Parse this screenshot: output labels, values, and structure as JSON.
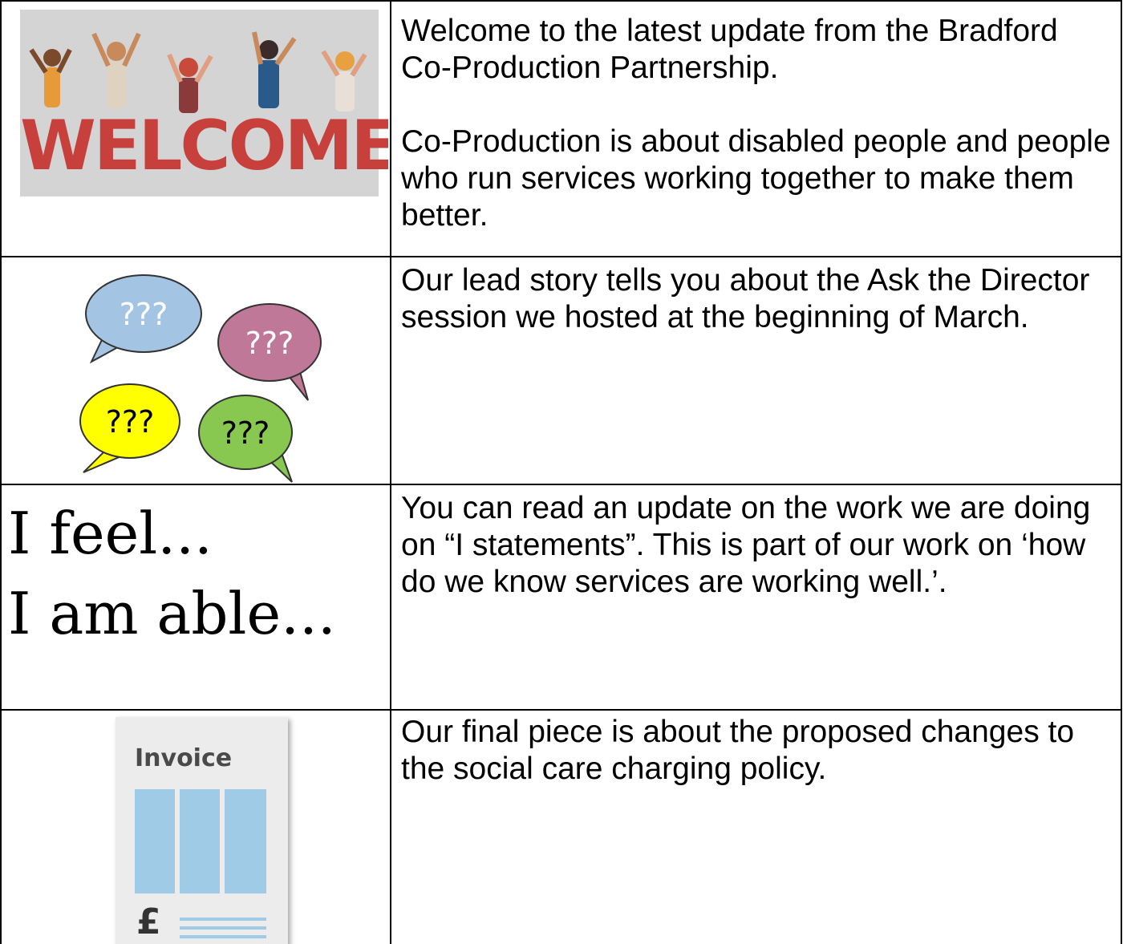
{
  "rows": [
    {
      "image": {
        "word": "WELCOME"
      },
      "paragraphs": [
        "Welcome to the latest update from the Bradford Co-Production Partnership.",
        "Co-Production is about disabled people and people who run services working together to make them better."
      ]
    },
    {
      "image": {
        "bubble_text": "???"
      },
      "paragraphs": [
        "Our lead story tells you about the Ask the Director session we hosted at the beginning of March."
      ]
    },
    {
      "image": {
        "line1": "I feel...",
        "line2": "I am able..."
      },
      "paragraphs": [
        "You can read an update on the work we are doing on “I statements”. This is part of our work on ‘how do we know services are working well.’."
      ]
    },
    {
      "image": {
        "title": "Invoice",
        "currency": "£"
      },
      "paragraphs": [
        "Our final piece is about the proposed changes to the social care charging policy."
      ]
    }
  ],
  "colors": {
    "welcome_red": "#c8403c",
    "bubble_blue": "#a4c4e4",
    "bubble_pink": "#c07898",
    "bubble_yellow": "#ffff00",
    "bubble_green": "#88c850",
    "invoice_blue": "#9fcbe6"
  }
}
